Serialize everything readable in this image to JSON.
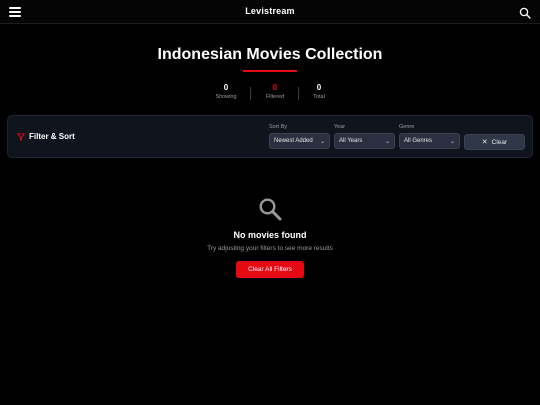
{
  "header": {
    "brand": "Levistream",
    "menu_icon": "hamburger-menu-icon",
    "search_icon": "search-icon"
  },
  "page": {
    "title": "Indonesian Movies Collection",
    "accent_color": "#e50914"
  },
  "stats": [
    {
      "value": "0",
      "label": "Showing"
    },
    {
      "value": "0",
      "label": "Filtered"
    },
    {
      "value": "0",
      "label": "Total"
    }
  ],
  "filters": {
    "title": "Filter & Sort",
    "icon": "funnel-icon",
    "sort_by": {
      "label": "Sort By",
      "value": "Newest Added"
    },
    "year": {
      "label": "Year",
      "value": "All Years"
    },
    "genre": {
      "label": "Genre",
      "value": "All Genres"
    },
    "clear_label": "Clear"
  },
  "empty_state": {
    "icon": "search-icon",
    "title": "No movies found",
    "subtitle": "Try adjusting your filters to see more results",
    "button_label": "Clear All Filters"
  }
}
